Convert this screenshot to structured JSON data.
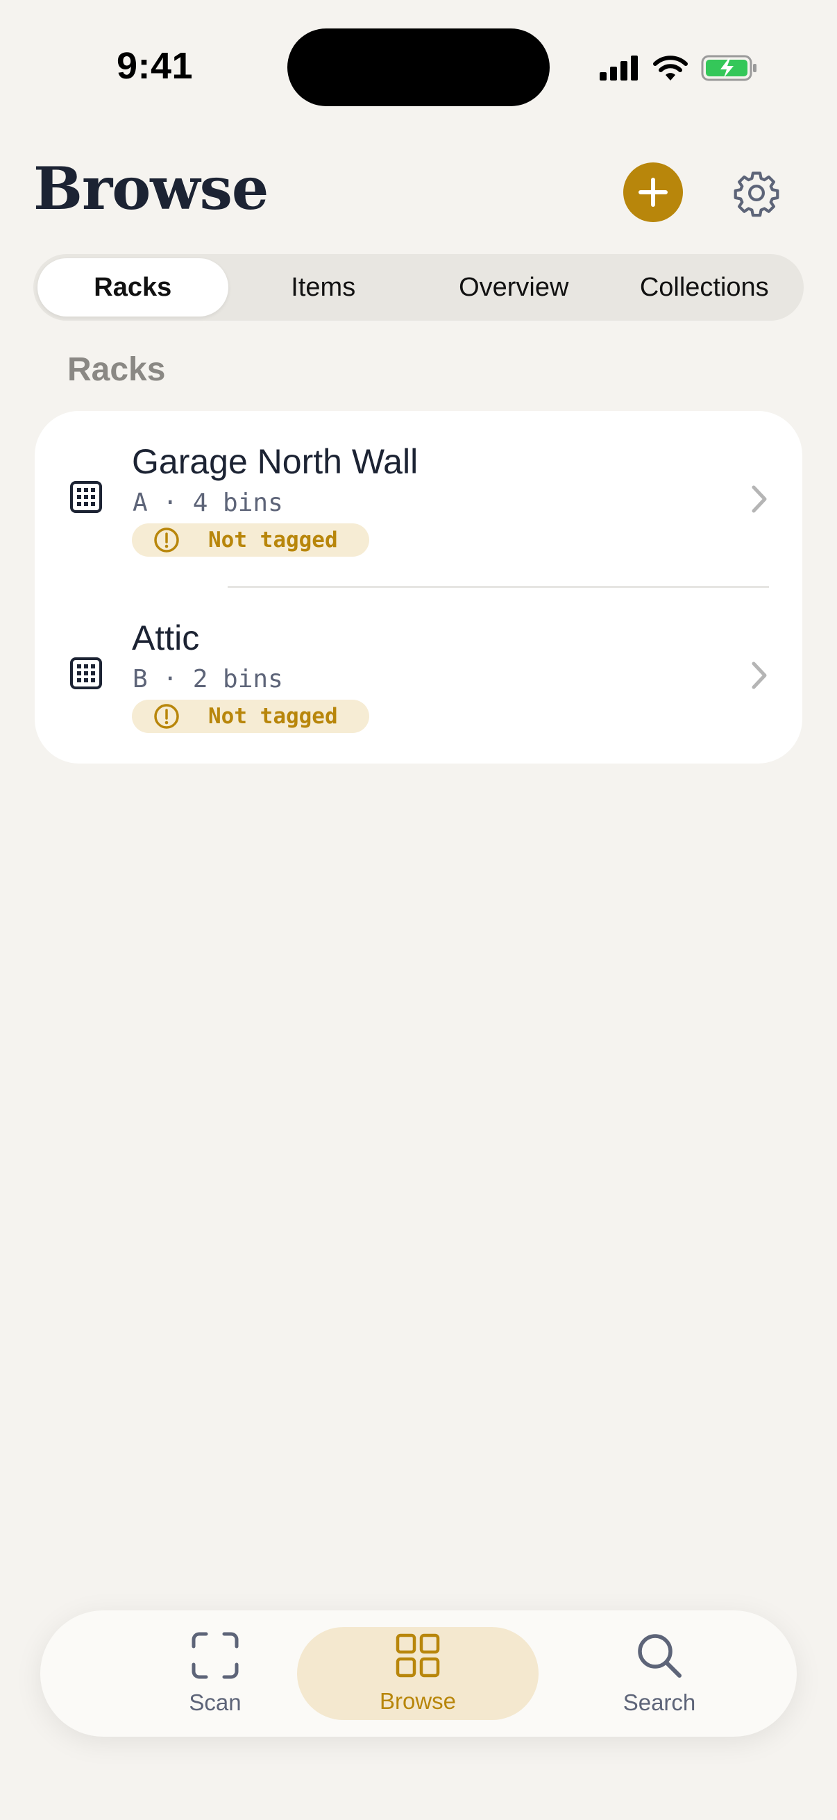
{
  "status_bar": {
    "time": "9:41"
  },
  "header": {
    "title": "Browse"
  },
  "segmented": {
    "tabs": [
      {
        "label": "Racks",
        "active": true
      },
      {
        "label": "Items",
        "active": false
      },
      {
        "label": "Overview",
        "active": false
      },
      {
        "label": "Collections",
        "active": false
      }
    ]
  },
  "section": {
    "title": "Racks"
  },
  "racks": [
    {
      "name": "Garage North Wall",
      "meta": "A · 4 bins",
      "tag": "Not tagged"
    },
    {
      "name": "Attic",
      "meta": "B · 2 bins",
      "tag": "Not tagged"
    }
  ],
  "tab_bar": {
    "scan": "Scan",
    "browse": "Browse",
    "search": "Search"
  },
  "colors": {
    "accent": "#b8860b",
    "navy": "#1c2333",
    "background": "#f5f3ef",
    "badge_bg": "#f6ecd4",
    "battery": "#34c759"
  },
  "icons": [
    "cellular-signal-icon",
    "wifi-icon",
    "battery-charging-icon",
    "plus-icon",
    "gear-icon",
    "rack-grid-icon",
    "alert-circle-icon",
    "chevron-right-icon",
    "scan-frame-icon",
    "grid-icon",
    "search-icon"
  ]
}
